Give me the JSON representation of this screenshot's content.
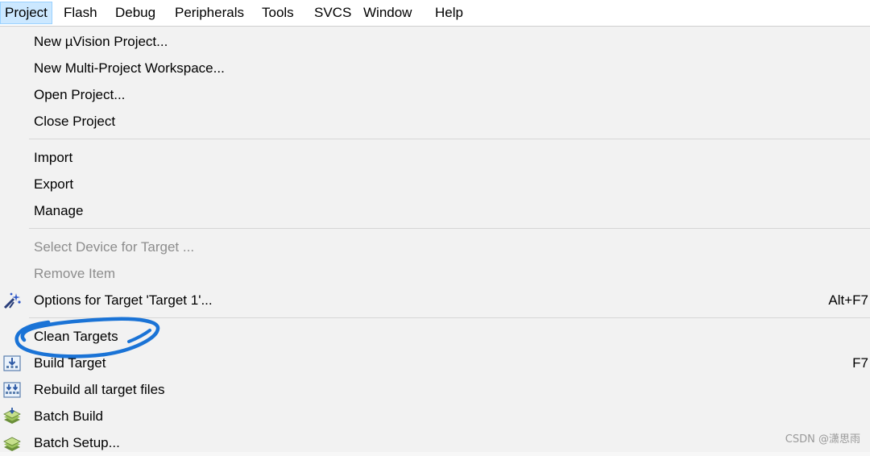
{
  "menubar": {
    "items": [
      {
        "label": "Project",
        "active": true
      },
      {
        "label": "Flash"
      },
      {
        "label": "Debug"
      },
      {
        "label": "Peripherals"
      },
      {
        "label": "Tools"
      },
      {
        "label": "SVCS"
      },
      {
        "label": "Window"
      },
      {
        "label": "Help"
      }
    ]
  },
  "dropdown": {
    "items": [
      {
        "label": "New µVision Project..."
      },
      {
        "label": "New Multi-Project Workspace..."
      },
      {
        "label": "Open Project..."
      },
      {
        "label": "Close Project"
      },
      {
        "label": "Import"
      },
      {
        "label": "Export"
      },
      {
        "label": "Manage"
      },
      {
        "label": "Select Device for Target ...",
        "disabled": true
      },
      {
        "label": "Remove Item",
        "disabled": true
      },
      {
        "label": "Options for Target 'Target 1'...",
        "shortcut": "Alt+F7",
        "icon": "options-wand-icon"
      },
      {
        "label": "Clean Targets"
      },
      {
        "label": "Build Target",
        "shortcut": "F7",
        "icon": "build-target-icon"
      },
      {
        "label": "Rebuild all target files",
        "icon": "rebuild-all-icon"
      },
      {
        "label": "Batch Build",
        "icon": "batch-build-icon"
      },
      {
        "label": "Batch Setup...",
        "icon": "batch-setup-icon"
      }
    ]
  },
  "annotation": {
    "color": "#1a73d6"
  },
  "watermark": "CSDN @潇思雨"
}
